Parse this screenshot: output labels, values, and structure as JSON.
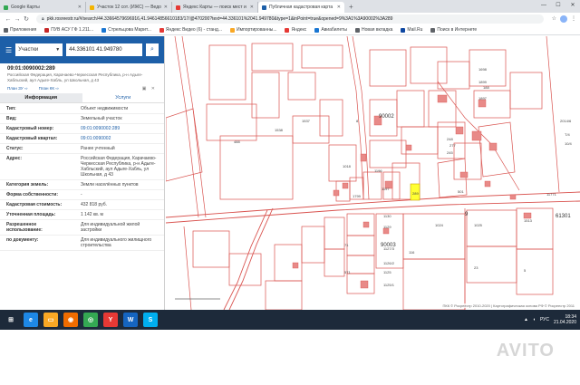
{
  "tabs": [
    {
      "title": "Google Карты",
      "color": "#34a853"
    },
    {
      "title": "Участок 12 сот. (ИЖС) — Ведо",
      "color": "#f4b400"
    },
    {
      "title": "Яндекс Карты — поиск мест и",
      "color": "#e53935"
    },
    {
      "title": "Публичная кадастровая карта",
      "color": "#1d5fa8",
      "active": true
    }
  ],
  "address_bar": {
    "url": "pkk.rosreestr.ru/#/search/44.33664579696916,41.94614856610183/17/@470200?text=44.336101%2041.949780&type=1&inPoint=true&opened=9%3A1%3A90002%3A289"
  },
  "bookmarks": [
    {
      "label": "Приложения",
      "color": "#5f6368"
    },
    {
      "label": "ПУВ АСУ ГФ 1.211...",
      "color": "#c62828"
    },
    {
      "label": "Стрельцова Марит...",
      "color": "#1976d2"
    },
    {
      "label": "Яндекс Видео (6) - станд...",
      "color": "#e53935"
    },
    {
      "label": "Импортированны...",
      "color": "#f9a825"
    },
    {
      "label": "Яндекс",
      "color": "#e53935"
    },
    {
      "label": "Авиабилеты",
      "color": "#1976d2"
    },
    {
      "label": "Новая вкладка",
      "color": "#5f6368"
    },
    {
      "label": "Mail.Ru",
      "color": "#0d47a1"
    },
    {
      "label": "Поиск в Интернете",
      "color": "#5f6368"
    }
  ],
  "search": {
    "type_label": "Участки",
    "query": "44.336101 41.949780"
  },
  "parcel": {
    "number": "09:01:0090002:289",
    "address_short": "Российская Федерация, Карачаево-Черкесская Республика, р-н Адыге-Хабльский, аул Адыге-Хабль, ул Школьная, д 43"
  },
  "plan_links": {
    "plan_zu": "План ЗУ ⇨",
    "plan_ks": "План КК ⇨"
  },
  "panel_tabs": {
    "info": "Информация",
    "services": "Услуги"
  },
  "info_rows": [
    {
      "key": "Тип:",
      "value": "Объект недвижимости"
    },
    {
      "key": "Вид:",
      "value": "Земельный участок"
    },
    {
      "key": "Кадастровый номер:",
      "value": "09:01:0090002:289",
      "link": true
    },
    {
      "key": "Кадастровый квартал:",
      "value": "09:01:0090002",
      "link": true
    },
    {
      "key": "Статус:",
      "value": "Ранее учтенный"
    },
    {
      "key": "Адрес:",
      "value": "Российская Федерация, Карачаево-Черкесская Республика, р-н Адыге-Хабльский, аул Адыге-Хабль, ул Школьная, д 43"
    },
    {
      "key": "Категория земель:",
      "value": "Земли населённых пунктов"
    },
    {
      "key": "Форма собственности:",
      "value": "-"
    },
    {
      "key": "Кадастровая стоимость:",
      "value": "432 818 руб."
    },
    {
      "key": "Уточненная площадь:",
      "value": "1 142 кв. м"
    },
    {
      "key": "Разрешенное использование:",
      "value": "Для индивидуальной жилой застройки"
    },
    {
      "key": "по документу:",
      "value": "Для индивидуального жилищного строительства"
    }
  ],
  "map": {
    "quarter_labels": [
      "90002",
      "90003",
      "9",
      "61301"
    ],
    "parcel_labels": [
      "1698",
      "1899",
      "188",
      "1897",
      "1538",
      "1537",
      "488",
      "8",
      "248",
      "245",
      "277",
      "1196",
      "1197",
      "71",
      "571",
      "1130",
      "1129",
      "1127/3",
      "1126/2",
      "1125",
      "1125/1",
      "116",
      "1024",
      "23",
      "5",
      "1025",
      "1513",
      "1018",
      "289",
      "501",
      "11771",
      "1799",
      "2014/6",
      "Т/4",
      "10/4"
    ],
    "attribution": "ПКК © Росреестр 2010-2020 | Картографическая основа РФ © Росреестр 2011",
    "highlight_color": "#ffff33",
    "outline_color": "#d9534f"
  },
  "taskbar": {
    "lang": "РУС",
    "time": "18:34",
    "date": "21.04.2020"
  },
  "watermark": "AVITO"
}
